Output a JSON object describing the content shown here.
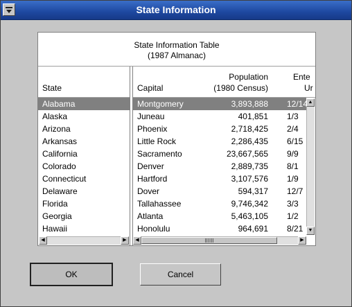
{
  "window": {
    "title": "State Information"
  },
  "table": {
    "title_line1": "State Information Table",
    "title_line2": "(1987 Almanac)",
    "headers": {
      "state": "State",
      "capital": "Capital",
      "population_line1": "Population",
      "population_line2": "(1980 Census)",
      "entered_line1": "Ente",
      "entered_line2": "Ur"
    },
    "selected_index": 0,
    "rows": [
      {
        "state": "Alabama",
        "capital": "Montgomery",
        "population": "3,893,888",
        "entered": "12/14"
      },
      {
        "state": "Alaska",
        "capital": "Juneau",
        "population": "401,851",
        "entered": "1/3"
      },
      {
        "state": "Arizona",
        "capital": "Phoenix",
        "population": "2,718,425",
        "entered": "2/4"
      },
      {
        "state": "Arkansas",
        "capital": "Little Rock",
        "population": "2,286,435",
        "entered": "6/15"
      },
      {
        "state": "California",
        "capital": "Sacramento",
        "population": "23,667,565",
        "entered": "9/9"
      },
      {
        "state": "Colorado",
        "capital": "Denver",
        "population": "2,889,735",
        "entered": "8/1"
      },
      {
        "state": "Connecticut",
        "capital": "Hartford",
        "population": "3,107,576",
        "entered": "1/9"
      },
      {
        "state": "Delaware",
        "capital": "Dover",
        "population": "594,317",
        "entered": "12/7"
      },
      {
        "state": "Florida",
        "capital": "Tallahassee",
        "population": "9,746,342",
        "entered": "3/3"
      },
      {
        "state": "Georgia",
        "capital": "Atlanta",
        "population": "5,463,105",
        "entered": "1/2"
      },
      {
        "state": "Hawaii",
        "capital": "Honolulu",
        "population": "964,691",
        "entered": "8/21"
      }
    ]
  },
  "buttons": {
    "ok": "OK",
    "cancel": "Cancel"
  },
  "icons": {
    "sysmenu": "window-menu-icon",
    "up": "scroll-up-arrow-icon",
    "down": "scroll-down-arrow-icon",
    "left": "scroll-left-arrow-icon",
    "right": "scroll-right-arrow-icon"
  },
  "colors": {
    "titlebar": "#1e48a0",
    "selection": "#808080"
  }
}
